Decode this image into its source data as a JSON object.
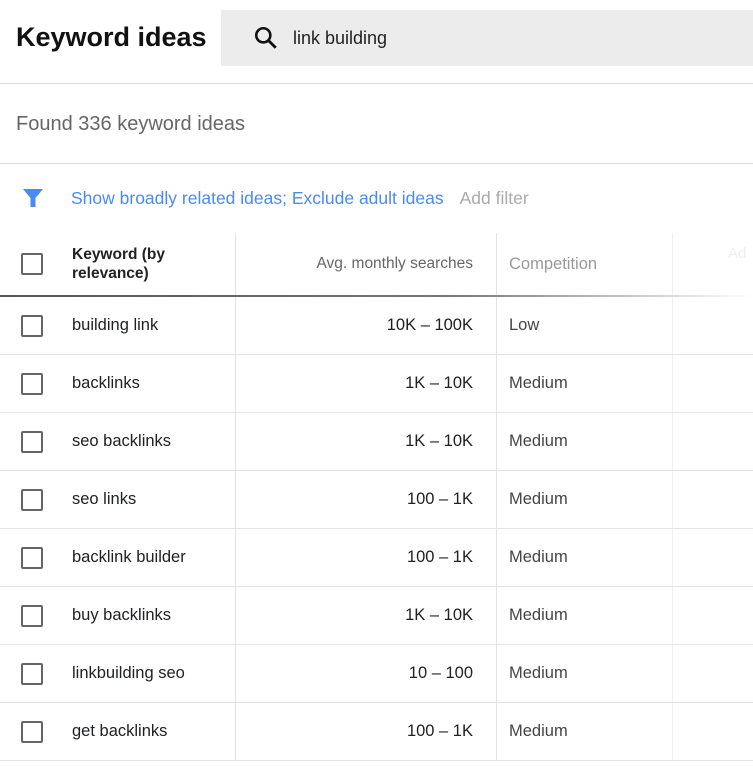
{
  "header": {
    "title": "Keyword ideas",
    "search_value": "link building"
  },
  "summary": "Found 336 keyword ideas",
  "filter": {
    "applied": "Show broadly related ideas; Exclude adult ideas",
    "add": "Add filter",
    "accent": "#4a8af4"
  },
  "table": {
    "columns": [
      "Keyword (by relevance)",
      "Avg. monthly searches",
      "Competition",
      "Ad"
    ],
    "rows": [
      {
        "keyword": "building link",
        "searches": "10K – 100K",
        "competition": "Low"
      },
      {
        "keyword": "backlinks",
        "searches": "1K – 10K",
        "competition": "Medium"
      },
      {
        "keyword": "seo backlinks",
        "searches": "1K – 10K",
        "competition": "Medium"
      },
      {
        "keyword": "seo links",
        "searches": "100 – 1K",
        "competition": "Medium"
      },
      {
        "keyword": "backlink builder",
        "searches": "100 – 1K",
        "competition": "Medium"
      },
      {
        "keyword": "buy backlinks",
        "searches": "1K – 10K",
        "competition": "Medium"
      },
      {
        "keyword": "linkbuilding seo",
        "searches": "10 – 100",
        "competition": "Medium"
      },
      {
        "keyword": "get backlinks",
        "searches": "100 – 1K",
        "competition": "Medium"
      }
    ]
  }
}
